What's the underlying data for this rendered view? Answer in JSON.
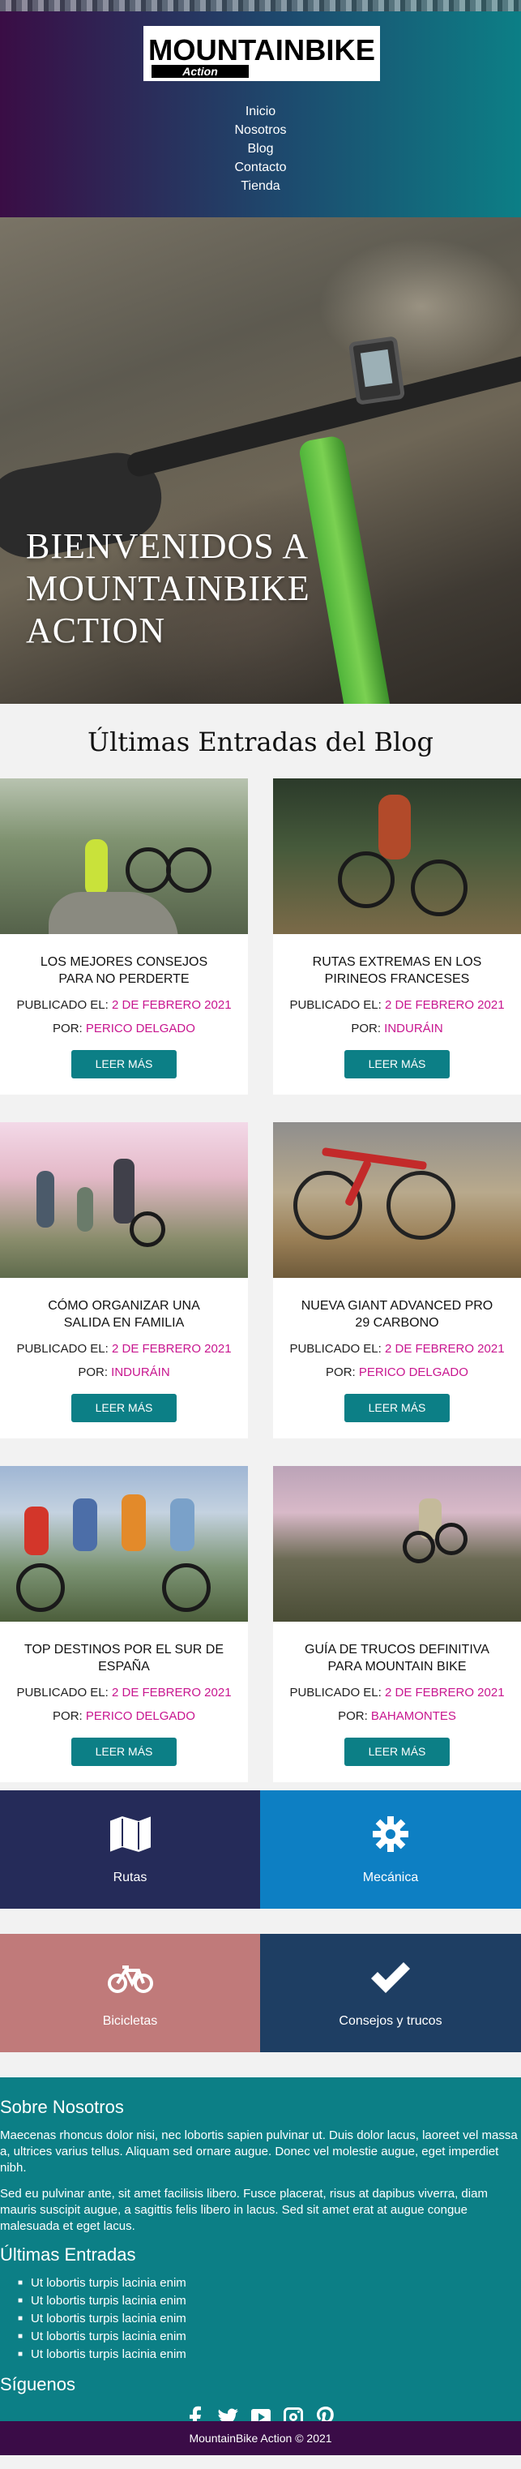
{
  "header": {
    "logo_text_main": "MOUNTAINBIKE",
    "logo_text_sub": "Action",
    "nav": [
      "Inicio",
      "Nosotros",
      "Blog",
      "Contacto",
      "Tienda"
    ]
  },
  "hero": {
    "title": "BIENVENIDOS A MOUNTAINBIKE ACTION"
  },
  "blog": {
    "heading": "Últimas Entradas del Blog",
    "posted_label": "PUBLICADO EL:",
    "by_label": "POR:",
    "button_label": "LEER MÁS",
    "posts": [
      {
        "title": "LOS MEJORES CONSEJOS PARA NO PERDERTE",
        "date": "2 de Febrero 2021",
        "author": "Perico Delgado"
      },
      {
        "title": "RUTAS EXTREMAS EN LOS PIRINEOS FRANCESES",
        "date": "2 de Febrero 2021",
        "author": "Induráin"
      },
      {
        "title": "CÓMO ORGANIZAR UNA SALIDA EN FAMILIA",
        "date": "2 de Febrero 2021",
        "author": "Induráin"
      },
      {
        "title": "NUEVA GIANT ADVANCED PRO 29 CARBONO",
        "date": "2 de Febrero 2021",
        "author": "Perico Delgado"
      },
      {
        "title": "TOP DESTINOS POR EL SUR DE ESPAÑA",
        "date": "2 de Febrero 2021",
        "author": "Perico Delgado"
      },
      {
        "title": "GUÍA DE TRUCOS DEFINITIVA PARA MOUNTAIN BIKE",
        "date": "2 de Febrero 2021",
        "author": "Bahamontes"
      }
    ]
  },
  "features": [
    {
      "label": "Rutas",
      "icon": "map-icon",
      "color": "#252b59"
    },
    {
      "label": "Mecánica",
      "icon": "gear-icon",
      "color": "#0d7fc3"
    },
    {
      "label": "Bicicletas",
      "icon": "bicycle-icon",
      "color": "#c07a7a"
    },
    {
      "label": "Consejos y trucos",
      "icon": "check-icon",
      "color": "#1e3e63"
    }
  ],
  "footer": {
    "about_heading": "Sobre Nosotros",
    "about_p1": "Maecenas rhoncus dolor nisi, nec lobortis sapien pulvinar ut. Duis dolor lacus, laoreet vel massa a, ultrices varius tellus. Aliquam sed ornare augue. Donec vel molestie augue, eget imperdiet nibh.",
    "about_p2": "Sed eu pulvinar ante, sit amet facilisis libero. Fusce placerat, risus at dapibus viverra, diam mauris suscipit augue, a sagittis felis libero in lacus. Sed sit amet erat at augue congue malesuada et eget lacus.",
    "latest_heading": "Últimas Entradas",
    "latest": [
      "Ut lobortis turpis lacinia enim",
      "Ut lobortis turpis lacinia enim",
      "Ut lobortis turpis lacinia enim",
      "Ut lobortis turpis lacinia enim",
      "Ut lobortis turpis lacinia enim"
    ],
    "follow_heading": "Síguenos",
    "social": [
      "facebook-icon",
      "twitter-icon",
      "youtube-icon",
      "instagram-icon",
      "pinterest-icon"
    ],
    "copyright": "MountainBike Action © 2021"
  },
  "colors": {
    "accent": "#0c7f86",
    "highlight": "#c8168f",
    "footer_bottom": "#3a0c47"
  }
}
